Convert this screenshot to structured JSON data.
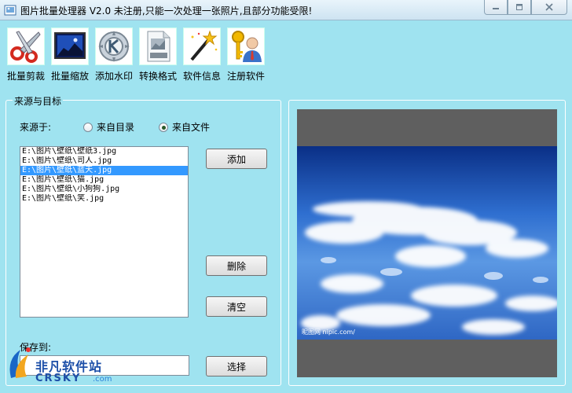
{
  "window": {
    "title": "图片批量处理器 V2.0  未注册,只能一次处理一张照片,且部分功能受限!",
    "controls": [
      "minimize-icon",
      "maximize-icon",
      "close-icon"
    ]
  },
  "toolbar": {
    "items": [
      {
        "label": "批量剪裁",
        "icon": "scissors-icon"
      },
      {
        "label": "批量缩放",
        "icon": "image-resize-icon"
      },
      {
        "label": "添加水印",
        "icon": "watermark-stamp-icon"
      },
      {
        "label": "转换格式",
        "icon": "jpeg-file-icon"
      },
      {
        "label": "软件信息",
        "icon": "magic-wand-icon"
      },
      {
        "label": "注册软件",
        "icon": "key-user-icon"
      }
    ]
  },
  "source_group": {
    "title": "来源与目标",
    "source_label": "来源于:",
    "radio_directory": "来自目录",
    "radio_file": "来自文件",
    "selected_source": "来自文件",
    "files": [
      "E:\\图片\\壁纸\\壁纸3.jpg",
      "E:\\图片\\壁纸\\司人.jpg",
      "E:\\图片\\壁纸\\蓝天.jpg",
      "E:\\图片\\壁纸\\猫.jpg",
      "E:\\图片\\壁纸\\小狗狗.jpg",
      "E:\\图片\\壁纸\\笑.jpg"
    ],
    "selected_index": 2,
    "add_button": "添加",
    "delete_button": "删除",
    "clear_button": "清空",
    "save_label": "保存到:",
    "save_value": "",
    "select_button": "选择"
  },
  "preview": {
    "watermark": "昵图网 nipic.com/"
  },
  "brand": {
    "name_cn": "非凡软件站",
    "name_en": "CRSKY",
    "domain": ".com"
  }
}
